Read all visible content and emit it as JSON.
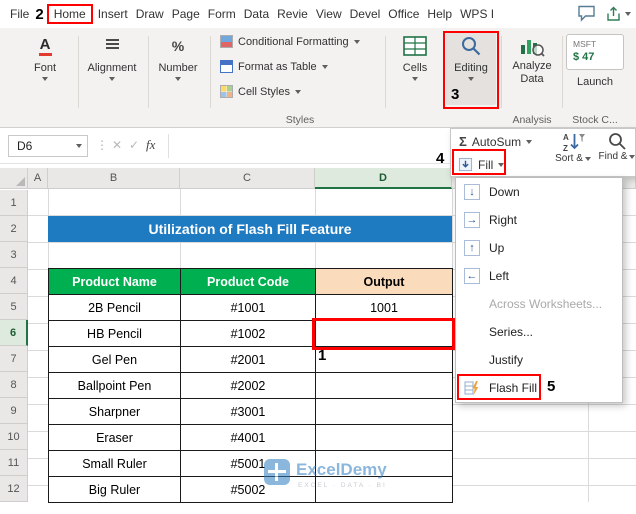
{
  "menu_bar": {
    "items": [
      "File",
      "Home",
      "Insert",
      "Draw",
      "Page",
      "Form",
      "Data",
      "Revie",
      "View",
      "Devel",
      "Office",
      "Help",
      "WPS I"
    ]
  },
  "steps": {
    "one": "1",
    "two": "2",
    "three": "3",
    "four": "4",
    "five": "5"
  },
  "ribbon": {
    "font_label": "Font",
    "font_icon_letter": "A",
    "alignment_label": "Alignment",
    "number_label": "Number",
    "number_icon": "%",
    "styles_items": [
      "Conditional Formatting",
      "Format as Table",
      "Cell Styles"
    ],
    "styles_group_label": "Styles",
    "cells_label": "Cells",
    "editing_label": "Editing",
    "analyze_line1": "Analyze",
    "analyze_line2": "Data",
    "analysis_group_label": "Analysis",
    "stock_ticker": "MSFT",
    "stock_price": "$ 47",
    "stock_launch": "Launch",
    "stock_group_label": "Stock C..."
  },
  "formula_bar": {
    "name_box": "D6",
    "fx": "fx"
  },
  "icons": {
    "sigma": "Σ",
    "cancel": "✕",
    "check": "✓",
    "dots": "⋮"
  },
  "editing_popup": {
    "autosum_label": "AutoSum",
    "fill_label": "Fill",
    "sort_label": "Sort &",
    "find_label": "Find &",
    "menu_items": [
      {
        "label": "Down",
        "icon_glyph": "↓"
      },
      {
        "label": "Right",
        "icon_glyph": "→"
      },
      {
        "label": "Up",
        "icon_glyph": "↑"
      },
      {
        "label": "Left",
        "icon_glyph": "←"
      },
      {
        "label": "Across Worksheets...",
        "disabled": true
      },
      {
        "label": "Series..."
      },
      {
        "label": "Justify"
      },
      {
        "label": "Flash Fill"
      }
    ]
  },
  "sheet": {
    "column_headers": [
      "A",
      "B",
      "C",
      "D"
    ],
    "row_headers": [
      "1",
      "2",
      "3",
      "4",
      "5",
      "6",
      "7",
      "8",
      "9",
      "10",
      "11",
      "12"
    ],
    "selected_cell": "D6",
    "title": "Utilization of Flash Fill Feature",
    "table": {
      "headers": [
        "Product Name",
        "Product Code",
        "Output"
      ],
      "rows": [
        {
          "name": "2B Pencil",
          "code": "#1001",
          "output": "1001"
        },
        {
          "name": "HB Pencil",
          "code": "#1002",
          "output": ""
        },
        {
          "name": "Gel Pen",
          "code": "#2001",
          "output": ""
        },
        {
          "name": "Ballpoint Pen",
          "code": "#2002",
          "output": ""
        },
        {
          "name": "Sharpner",
          "code": "#3001",
          "output": ""
        },
        {
          "name": "Eraser",
          "code": "#4001",
          "output": ""
        },
        {
          "name": "Small Ruler",
          "code": "#5001",
          "output": ""
        },
        {
          "name": "Big Ruler",
          "code": "#5002",
          "output": ""
        }
      ]
    },
    "watermark": {
      "name": "ExcelDemy",
      "tagline": "EXCEL · DATA · BI"
    }
  },
  "colors": {
    "annotation_red": "#ff0000",
    "banner_blue": "#1e7bc2",
    "header_green": "#00b050",
    "output_peach": "#fadcbc",
    "excel_green": "#217346",
    "watermark_blue": "#2d7dc1"
  }
}
